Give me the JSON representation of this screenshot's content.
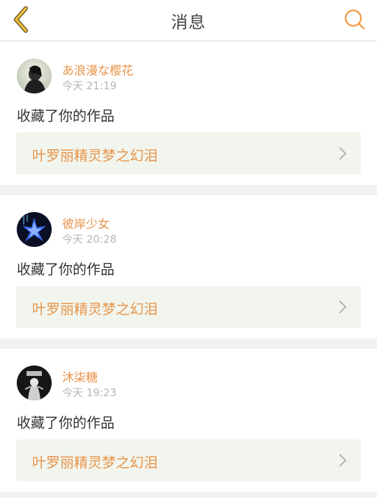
{
  "header": {
    "title": "消息",
    "back_icon": "chevron-left-icon",
    "search_icon": "search-icon",
    "accent_color": "#f0c040"
  },
  "messages": [
    {
      "username": "あ浪漫な樱花",
      "time": "今天 21:19",
      "action": "收藏了你的作品",
      "work_title": "叶罗丽精灵梦之幻泪"
    },
    {
      "username": "彼岸少女",
      "time": "今天 20:28",
      "action": "收藏了你的作品",
      "work_title": "叶罗丽精灵梦之幻泪"
    },
    {
      "username": "沐柒糖",
      "time": "今天 19:23",
      "action": "收藏了你的作品",
      "work_title": "叶罗丽精灵梦之幻泪"
    }
  ],
  "colors": {
    "username": "#e8944a",
    "work_link_bg": "#f1f5ed"
  }
}
